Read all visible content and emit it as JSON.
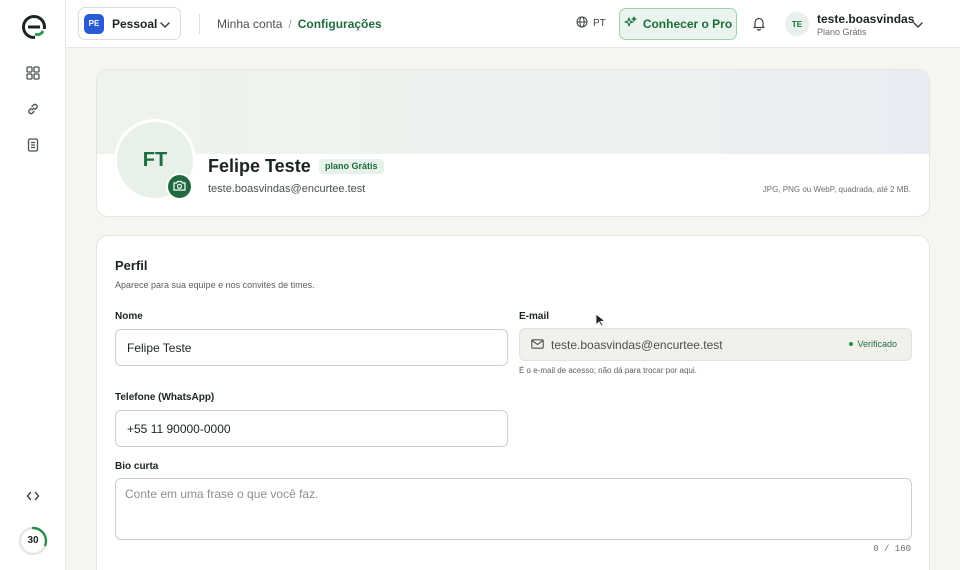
{
  "sidebar": {
    "items": [
      {
        "icon": "dashboard-icon"
      },
      {
        "icon": "link-icon"
      },
      {
        "icon": "document-icon"
      },
      {
        "icon": "code-icon"
      }
    ],
    "usage_count": "30",
    "usage_fraction": 0.3
  },
  "header": {
    "workspace": {
      "badge": "PE",
      "label": "Pessoal"
    },
    "breadcrumb": {
      "parent": "Minha conta",
      "separator": "/",
      "current": "Configurações"
    },
    "language": "PT",
    "pro_button": "Conhecer o Pro",
    "user": {
      "initials": "TE",
      "name": "teste.boasvindas",
      "plan": "Plano Grátis"
    }
  },
  "profile": {
    "initials": "FT",
    "name": "Felipe Teste",
    "plan_badge": "plano Grátis",
    "email": "teste.boasvindas@encurtee.test",
    "photo_hint": "JPG, PNG ou WebP, quadrada, até 2 MB."
  },
  "form": {
    "title": "Perfil",
    "subtitle": "Aparece para sua equipe e nos convites de times.",
    "name_label": "Nome",
    "name_value": "Felipe Teste",
    "email_label": "E-mail",
    "email_value": "teste.boasvindas@encurtee.test",
    "email_status": "Verificado",
    "email_hint": "É o e-mail de acesso; não dá para trocar por aqui.",
    "phone_label": "Telefone (WhatsApp)",
    "phone_value": "+55 11 90000-0000",
    "bio_label": "Bio curta",
    "bio_placeholder": "Conte em uma frase o que você faz.",
    "bio_counter": "0 / 160"
  },
  "colors": {
    "accent": "#1f6b3f",
    "accent_soft": "#e7f3ea",
    "workspace_badge": "#2a5bd7"
  }
}
